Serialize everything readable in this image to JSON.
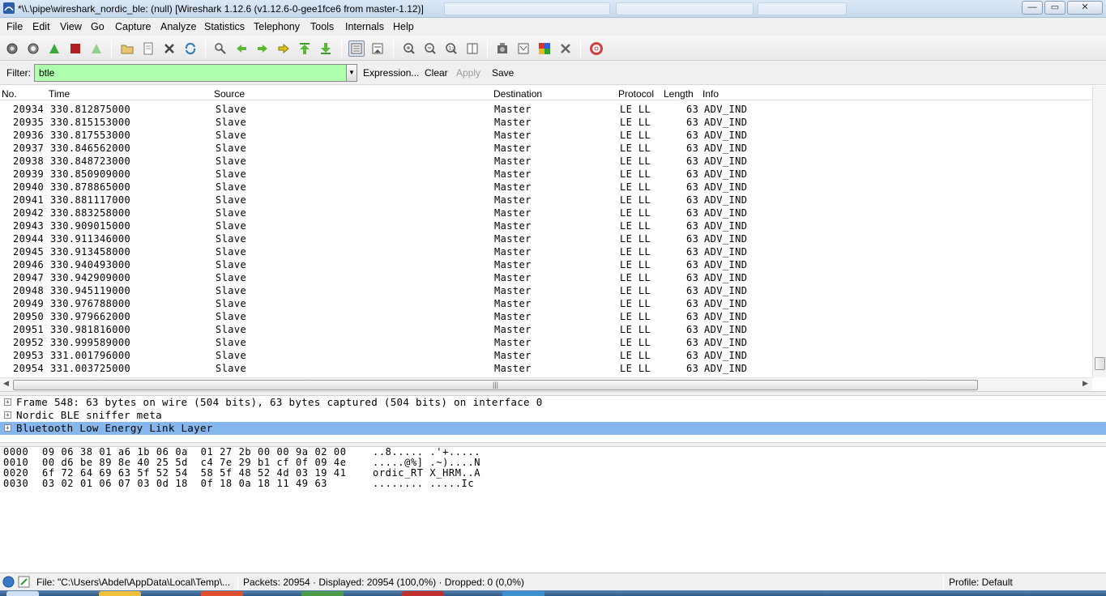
{
  "window": {
    "title": "*\\\\.\\pipe\\wireshark_nordic_ble: (null)   [Wireshark 1.12.6  (v1.12.6-0-gee1fce6 from master-1.12)]",
    "minimize": "—",
    "maximize": "▭",
    "close": "✕"
  },
  "menu": [
    "File",
    "Edit",
    "View",
    "Go",
    "Capture",
    "Analyze",
    "Statistics",
    "Telephony",
    "Tools",
    "Internals",
    "Help"
  ],
  "toolbar_icons": [
    "interface-list-icon",
    "capture-options-icon",
    "start-capture-icon",
    "stop-capture-icon",
    "restart-capture-icon",
    "open-file-icon",
    "save-file-icon",
    "close-file-icon",
    "reload-icon",
    "find-packet-icon",
    "go-back-icon",
    "go-forward-icon",
    "go-to-packet-icon",
    "go-first-icon",
    "go-last-icon",
    "colorize-icon",
    "auto-scroll-icon",
    "zoom-in-icon",
    "zoom-out-icon",
    "zoom-normal-icon",
    "resize-columns-icon",
    "capture-filters-icon",
    "display-filters-icon",
    "coloring-rules-icon",
    "preferences-icon",
    "help-icon"
  ],
  "filter": {
    "label": "Filter:",
    "value": "btle",
    "expression": "Expression...",
    "clear": "Clear",
    "apply": "Apply",
    "save": "Save",
    "bg_color": "#afffaf"
  },
  "packet_list": {
    "columns": [
      "No.",
      "Time",
      "Source",
      "Destination",
      "Protocol",
      "Length",
      "Info"
    ],
    "rows": [
      {
        "no": "20934",
        "time": "330.812875000",
        "src": "Slave",
        "dst": "Master",
        "proto": "LE LL",
        "len": "63",
        "info": "ADV_IND"
      },
      {
        "no": "20935",
        "time": "330.815153000",
        "src": "Slave",
        "dst": "Master",
        "proto": "LE LL",
        "len": "63",
        "info": "ADV_IND"
      },
      {
        "no": "20936",
        "time": "330.817553000",
        "src": "Slave",
        "dst": "Master",
        "proto": "LE LL",
        "len": "63",
        "info": "ADV_IND"
      },
      {
        "no": "20937",
        "time": "330.846562000",
        "src": "Slave",
        "dst": "Master",
        "proto": "LE LL",
        "len": "63",
        "info": "ADV_IND"
      },
      {
        "no": "20938",
        "time": "330.848723000",
        "src": "Slave",
        "dst": "Master",
        "proto": "LE LL",
        "len": "63",
        "info": "ADV_IND"
      },
      {
        "no": "20939",
        "time": "330.850909000",
        "src": "Slave",
        "dst": "Master",
        "proto": "LE LL",
        "len": "63",
        "info": "ADV_IND"
      },
      {
        "no": "20940",
        "time": "330.878865000",
        "src": "Slave",
        "dst": "Master",
        "proto": "LE LL",
        "len": "63",
        "info": "ADV_IND"
      },
      {
        "no": "20941",
        "time": "330.881117000",
        "src": "Slave",
        "dst": "Master",
        "proto": "LE LL",
        "len": "63",
        "info": "ADV_IND"
      },
      {
        "no": "20942",
        "time": "330.883258000",
        "src": "Slave",
        "dst": "Master",
        "proto": "LE LL",
        "len": "63",
        "info": "ADV_IND"
      },
      {
        "no": "20943",
        "time": "330.909015000",
        "src": "Slave",
        "dst": "Master",
        "proto": "LE LL",
        "len": "63",
        "info": "ADV_IND"
      },
      {
        "no": "20944",
        "time": "330.911346000",
        "src": "Slave",
        "dst": "Master",
        "proto": "LE LL",
        "len": "63",
        "info": "ADV_IND"
      },
      {
        "no": "20945",
        "time": "330.913458000",
        "src": "Slave",
        "dst": "Master",
        "proto": "LE LL",
        "len": "63",
        "info": "ADV_IND"
      },
      {
        "no": "20946",
        "time": "330.940493000",
        "src": "Slave",
        "dst": "Master",
        "proto": "LE LL",
        "len": "63",
        "info": "ADV_IND"
      },
      {
        "no": "20947",
        "time": "330.942909000",
        "src": "Slave",
        "dst": "Master",
        "proto": "LE LL",
        "len": "63",
        "info": "ADV_IND"
      },
      {
        "no": "20948",
        "time": "330.945119000",
        "src": "Slave",
        "dst": "Master",
        "proto": "LE LL",
        "len": "63",
        "info": "ADV_IND"
      },
      {
        "no": "20949",
        "time": "330.976788000",
        "src": "Slave",
        "dst": "Master",
        "proto": "LE LL",
        "len": "63",
        "info": "ADV_IND"
      },
      {
        "no": "20950",
        "time": "330.979662000",
        "src": "Slave",
        "dst": "Master",
        "proto": "LE LL",
        "len": "63",
        "info": "ADV_IND"
      },
      {
        "no": "20951",
        "time": "330.981816000",
        "src": "Slave",
        "dst": "Master",
        "proto": "LE LL",
        "len": "63",
        "info": "ADV_IND"
      },
      {
        "no": "20952",
        "time": "330.999589000",
        "src": "Slave",
        "dst": "Master",
        "proto": "LE LL",
        "len": "63",
        "info": "ADV_IND"
      },
      {
        "no": "20953",
        "time": "331.001796000",
        "src": "Slave",
        "dst": "Master",
        "proto": "LE LL",
        "len": "63",
        "info": "ADV_IND"
      },
      {
        "no": "20954",
        "time": "331.003725000",
        "src": "Slave",
        "dst": "Master",
        "proto": "LE LL",
        "len": "63",
        "info": "ADV_IND"
      }
    ]
  },
  "details": [
    {
      "text": "Frame 548: 63 bytes on wire (504 bits), 63 bytes captured (504 bits) on interface 0",
      "selected": false
    },
    {
      "text": "Nordic BLE sniffer meta",
      "selected": false
    },
    {
      "text": "Bluetooth Low Energy Link Layer",
      "selected": true
    }
  ],
  "bytes": [
    {
      "off": "0000",
      "hex": "09 06 38 01 a6 1b 06 0a  01 27 2b 00 00 9a 02 00",
      "asc": "..8..... .'+....."
    },
    {
      "off": "0010",
      "hex": "00 d6 be 89 8e 40 25 5d  c4 7e 29 b1 cf 0f 09 4e",
      "asc": ".....@%] .~)....N"
    },
    {
      "off": "0020",
      "hex": "6f 72 64 69 63 5f 52 54  58 5f 48 52 4d 03 19 41",
      "asc": "ordic_RT X_HRM..A"
    },
    {
      "off": "0030",
      "hex": "03 02 01 06 07 03 0d 18  0f 18 0a 18 11 49 63",
      "asc": "........ .....Ic"
    }
  ],
  "status": {
    "file": "File: \"C:\\Users\\Abdel\\AppData\\Local\\Temp\\...",
    "packets": "Packets: 20954 · Displayed: 20954 (100,0%) · Dropped: 0 (0,0%)",
    "profile": "Profile: Default"
  }
}
